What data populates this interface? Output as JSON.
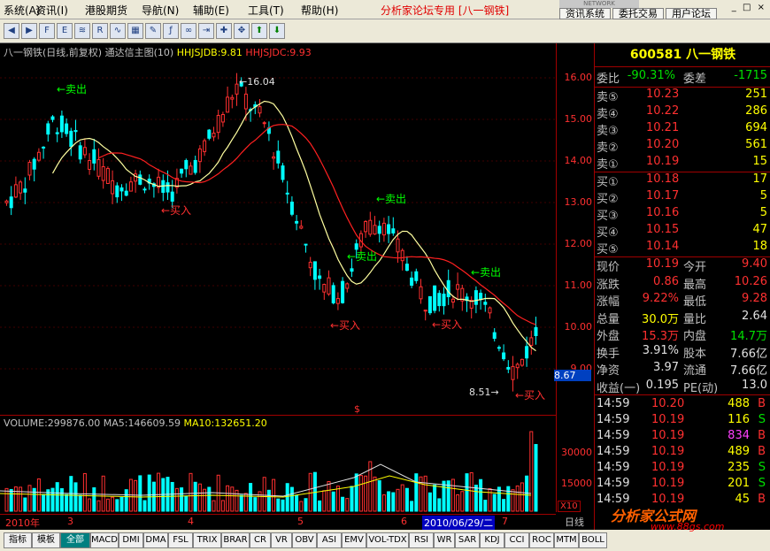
{
  "menu": [
    "系统(A)",
    "资讯(I)",
    "港股期货",
    "导航(N)",
    "辅助(E)",
    "工具(T)",
    "帮助(H)"
  ],
  "forum_label": "分析家论坛专用 [八一钢铁]",
  "top_buttons": [
    "资讯系统",
    "委托交易",
    "用户论坛"
  ],
  "logo_text": "NETWORK",
  "chart": {
    "title_name": "八一钢铁(日线,前复权)",
    "title_formula": "通达信主图(10)",
    "ind1": "HHJSJDB:9.81",
    "ind2": "HHJSJDC:9.93",
    "price_ticks": [
      "16.00",
      "15.00",
      "14.00",
      "13.00",
      "12.00",
      "11.00",
      "10.00",
      "9.00"
    ],
    "current_price_tag": "8.67",
    "high_label": "16.04",
    "low_label": "8.51",
    "signals": {
      "sell": "卖出",
      "buy": "买入"
    },
    "marker": "$"
  },
  "volume": {
    "title": "VOLUME:299876.00",
    "ma5": "MA5:146609.59",
    "ma10": "MA10:132651.20",
    "ticks": [
      "30000",
      "15000"
    ],
    "unit": "X10"
  },
  "dates": {
    "labels": [
      "2010年",
      "3",
      "4",
      "5",
      "6",
      "7"
    ],
    "highlight": "2010/06/29/二",
    "day_label": "日线"
  },
  "tabs": [
    "指标",
    "模板",
    "全部",
    "MACD",
    "DMI",
    "DMA",
    "FSL",
    "TRIX",
    "BRAR",
    "CR",
    "VR",
    "OBV",
    "ASI",
    "EMV",
    "VOL-TDX",
    "RSI",
    "WR",
    "SAR",
    "KDJ",
    "CCI",
    "ROC",
    "MTM",
    "BOLL"
  ],
  "quote": {
    "code": "600581",
    "name": "八一钢铁",
    "weibi_label": "委比",
    "weibi": "-90.31%",
    "weicha_label": "委差",
    "weicha": "-1715",
    "sells": [
      {
        "label": "卖⑤",
        "price": "10.23",
        "vol": "251"
      },
      {
        "label": "卖④",
        "price": "10.22",
        "vol": "286"
      },
      {
        "label": "卖③",
        "price": "10.21",
        "vol": "694"
      },
      {
        "label": "卖②",
        "price": "10.20",
        "vol": "561"
      },
      {
        "label": "卖①",
        "price": "10.19",
        "vol": "15"
      }
    ],
    "buys": [
      {
        "label": "买①",
        "price": "10.18",
        "vol": "17"
      },
      {
        "label": "买②",
        "price": "10.17",
        "vol": "5"
      },
      {
        "label": "买③",
        "price": "10.16",
        "vol": "5"
      },
      {
        "label": "买④",
        "price": "10.15",
        "vol": "47"
      },
      {
        "label": "买⑤",
        "price": "10.14",
        "vol": "18"
      }
    ],
    "stats": [
      {
        "l1": "现价",
        "v1": "10.19",
        "l2": "今开",
        "v2": "9.40"
      },
      {
        "l1": "涨跌",
        "v1": "0.86",
        "l2": "最高",
        "v2": "10.26"
      },
      {
        "l1": "涨幅",
        "v1": "9.22%",
        "l2": "最低",
        "v2": "9.28"
      },
      {
        "l1": "总量",
        "v1": "30.0万",
        "l2": "量比",
        "v2": "2.64"
      },
      {
        "l1": "外盘",
        "v1": "15.3万",
        "l2": "内盘",
        "v2": "14.7万"
      },
      {
        "l1": "换手",
        "v1": "3.91%",
        "l2": "股本",
        "v2": "7.66亿"
      },
      {
        "l1": "净资",
        "v1": "3.97",
        "l2": "流通",
        "v2": "7.66亿"
      },
      {
        "l1": "收益(一)",
        "v1": "0.195",
        "l2": "PE(动)",
        "v2": "13.0"
      }
    ],
    "ticks": [
      {
        "time": "14:59",
        "price": "10.20",
        "vol": "488",
        "side": "B"
      },
      {
        "time": "14:59",
        "price": "10.19",
        "vol": "116",
        "side": "S"
      },
      {
        "time": "14:59",
        "price": "10.19",
        "vol": "834",
        "side": "B"
      },
      {
        "time": "14:59",
        "price": "10.19",
        "vol": "489",
        "side": "B"
      },
      {
        "time": "14:59",
        "price": "10.19",
        "vol": "235",
        "side": "S"
      },
      {
        "time": "14:59",
        "price": "10.19",
        "vol": "201",
        "side": "S"
      },
      {
        "time": "14:59",
        "price": "10.19",
        "vol": "45",
        "side": "B"
      }
    ]
  },
  "watermark": {
    "brand": "分析家公式网",
    "url": "www.88gs.com"
  }
}
